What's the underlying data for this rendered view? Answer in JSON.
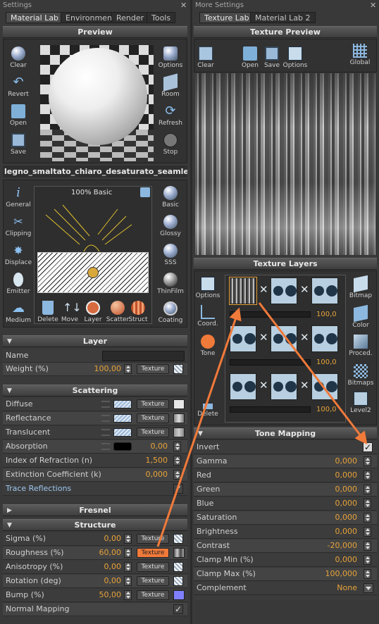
{
  "left": {
    "title": "Settings",
    "close": "✕",
    "tabs": [
      "Material Lab",
      "Environment",
      "Render",
      "Tools"
    ],
    "preview": {
      "title": "Preview",
      "tools_left": [
        "Clear",
        "Revert",
        "Open",
        "Save"
      ],
      "tools_right": [
        "Options",
        "Room",
        "Refresh",
        "Stop"
      ]
    },
    "material_name": "legno_smaltato_chiaro_desaturato_seamles",
    "editor": {
      "left_icons": [
        "General",
        "Clipping",
        "Displace",
        "Emitter",
        "Medium"
      ],
      "right_icons": [
        "Basic",
        "Glossy",
        "SSS",
        "ThinFilm",
        "Coating"
      ],
      "badge": "100% Basic",
      "bottom_icons": [
        "Delete",
        "Move",
        "Layer",
        "Scatter",
        "Struct"
      ]
    },
    "layer": {
      "title": "Layer",
      "name_label": "Name",
      "name_value": "",
      "weight_label": "Weight (%)",
      "weight_value": "100,00",
      "texture_btn": "Texture"
    },
    "scattering": {
      "title": "Scattering",
      "rows": [
        {
          "label": "Diffuse",
          "type": "tex"
        },
        {
          "label": "Reflectance",
          "type": "tex"
        },
        {
          "label": "Translucent",
          "type": "tex"
        },
        {
          "label": "Absorption",
          "type": "val",
          "value": "0,00"
        },
        {
          "label": "Index of Refraction (n)",
          "type": "num",
          "value": "1,500"
        },
        {
          "label": "Extinction Coefficient (k)",
          "type": "num",
          "value": "0,000"
        },
        {
          "label": "Trace Reflections",
          "type": "check"
        }
      ],
      "texture_btn": "Texture"
    },
    "fresnel": {
      "title": "Fresnel"
    },
    "structure": {
      "title": "Structure",
      "rows": [
        {
          "label": "Sigma (%)",
          "value": "0,00"
        },
        {
          "label": "Roughness (%)",
          "value": "60,00"
        },
        {
          "label": "Anisotropy (%)",
          "value": "0,00"
        },
        {
          "label": "Rotation (deg)",
          "value": "0,00"
        },
        {
          "label": "Bump (%)",
          "value": "50,00"
        }
      ],
      "normal_mapping": "Normal Mapping",
      "texture_btn": "Texture"
    }
  },
  "right": {
    "title": "More Settings",
    "close": "✕",
    "tabs": [
      "Texture Lab",
      "Material Lab 2"
    ],
    "preview": {
      "title": "Texture Preview",
      "tools": [
        "Clear",
        "Open",
        "Save",
        "Options"
      ],
      "global": "Global"
    },
    "layers": {
      "title": "Texture Layers",
      "left_icons": [
        "Options",
        "Coord.",
        "Tone",
        "Delete"
      ],
      "right_icons": [
        "Bitmap",
        "Color",
        "Proced.",
        "Bitmaps",
        "Level2"
      ],
      "values": [
        "100,0",
        "100,0",
        "100,0"
      ]
    },
    "tone": {
      "title": "Tone Mapping",
      "invert": "Invert",
      "rows": [
        {
          "label": "Gamma",
          "value": "0,000"
        },
        {
          "label": "Red",
          "value": "0,000"
        },
        {
          "label": "Green",
          "value": "0,000"
        },
        {
          "label": "Blue",
          "value": "0,000"
        },
        {
          "label": "Saturation",
          "value": "0,000"
        },
        {
          "label": "Brightness",
          "value": "0,000"
        },
        {
          "label": "Contrast",
          "value": "-20,000"
        },
        {
          "label": "Clamp Min (%)",
          "value": "0,000"
        },
        {
          "label": "Clamp Max (%)",
          "value": "100,000"
        }
      ],
      "complement": "Complement",
      "complement_value": "None"
    }
  },
  "colors": {
    "accent": "#f07a3a",
    "value": "#e8a33a"
  }
}
